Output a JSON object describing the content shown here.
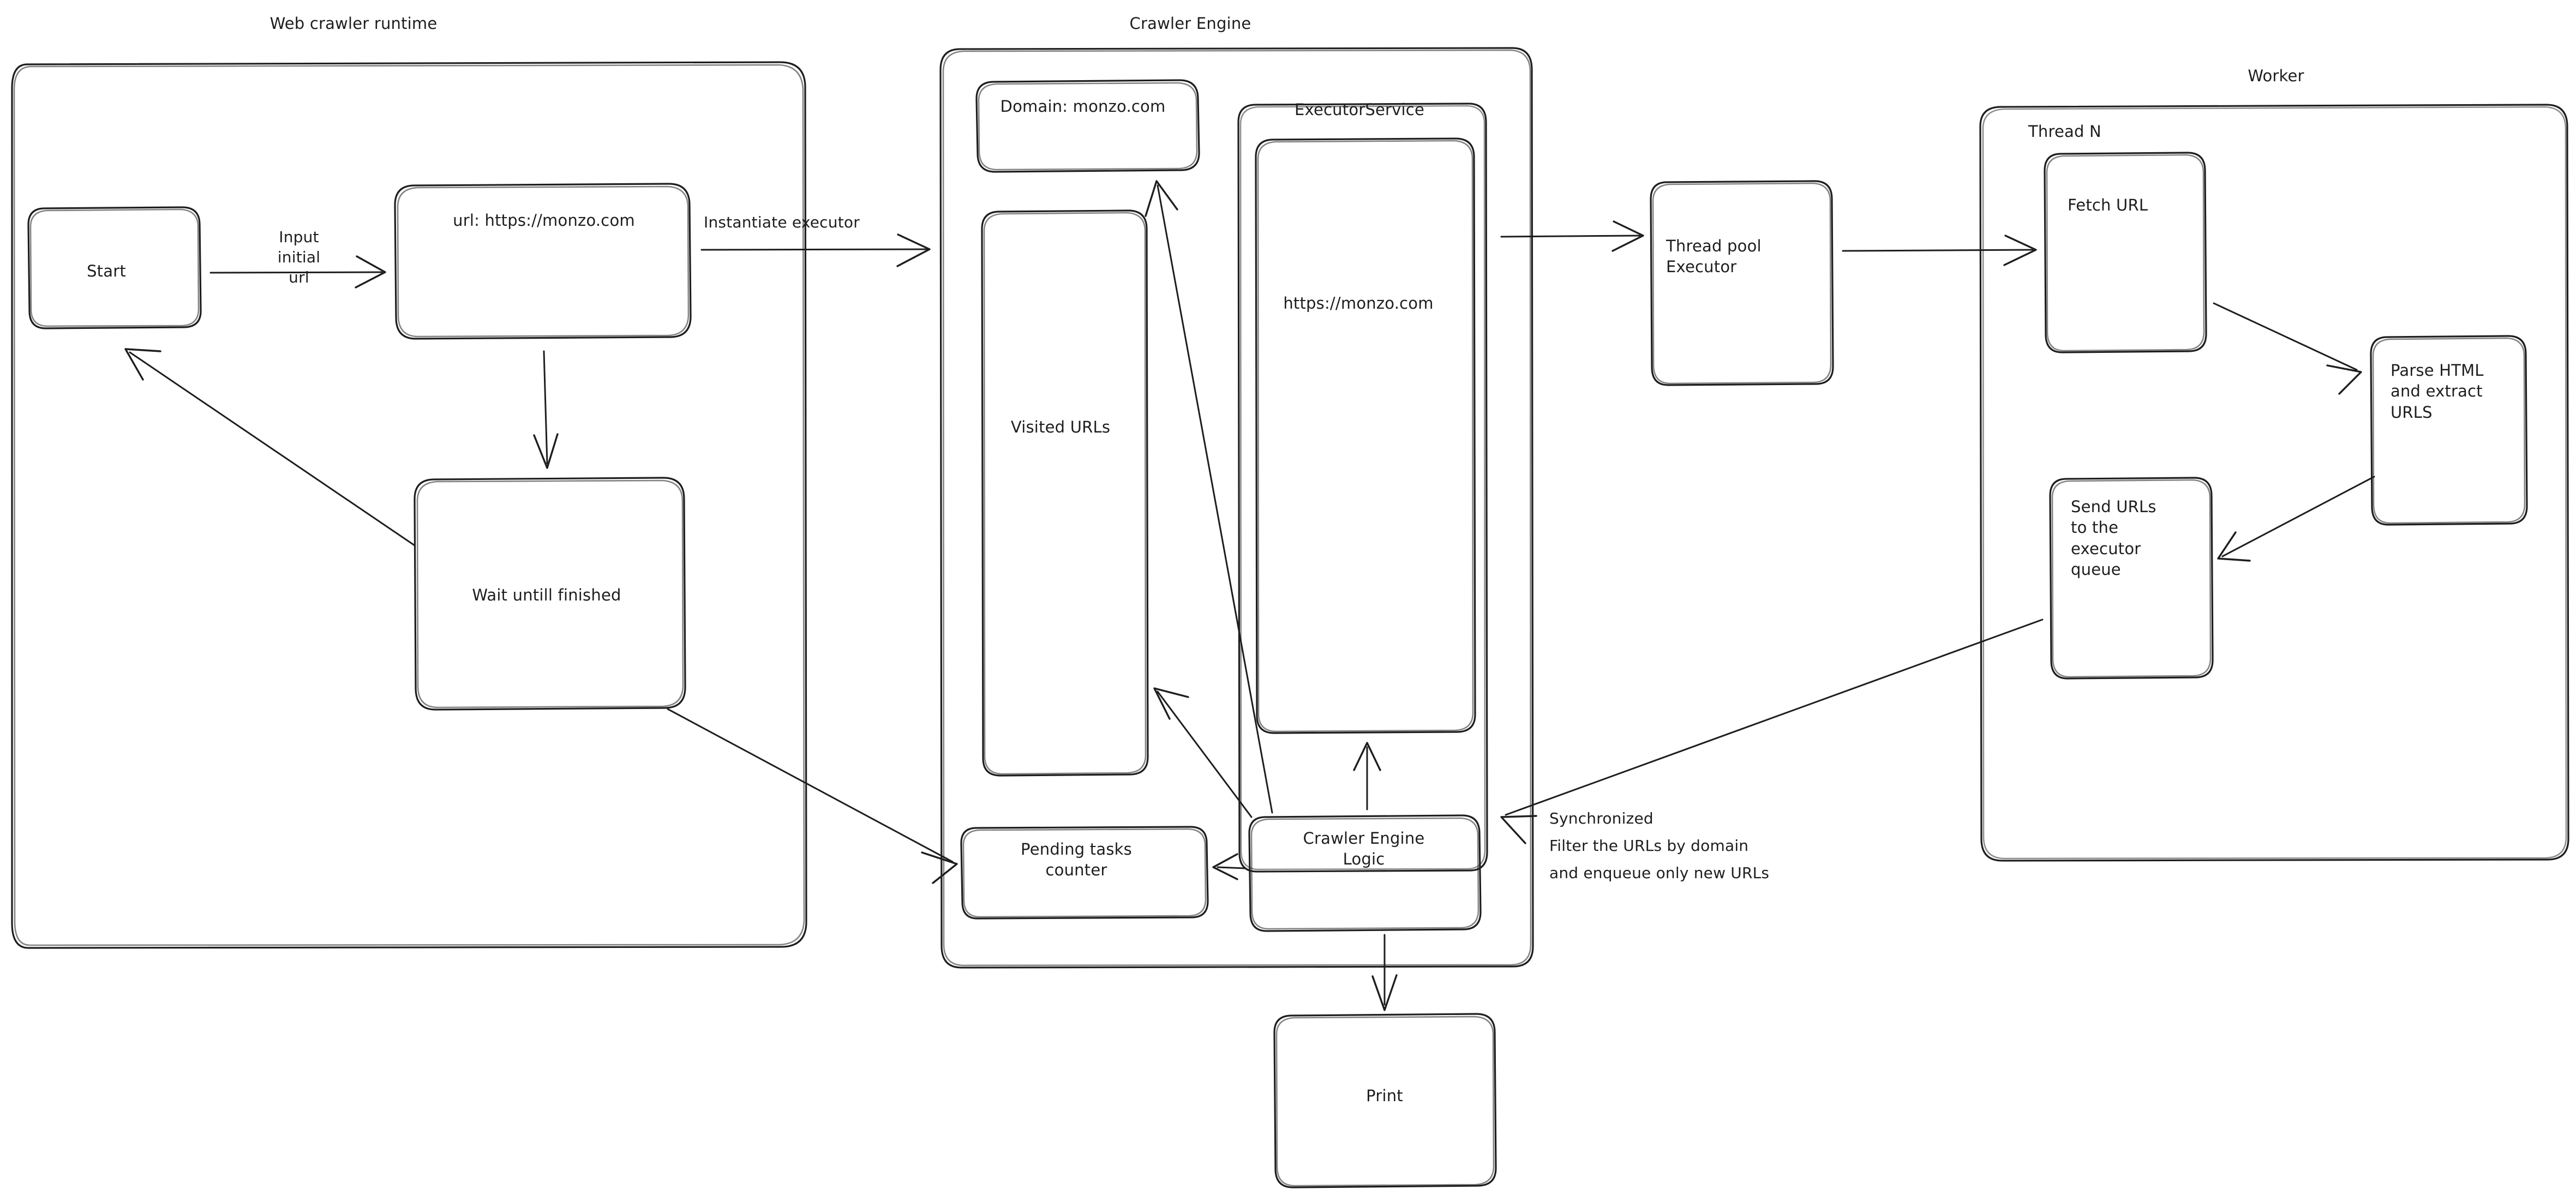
{
  "diagram": {
    "style": "hand-drawn",
    "background_color": "#ffffff",
    "stroke_color": "#1e1e1e",
    "groups": [
      {
        "id": "web-crawler-runtime",
        "label": "Web crawler runtime"
      },
      {
        "id": "crawler-engine",
        "label": "Crawler Engine"
      },
      {
        "id": "executor-service",
        "label": "ExecutorService"
      },
      {
        "id": "worker",
        "label": "Worker"
      },
      {
        "id": "thread-n",
        "label": "Thread N"
      }
    ],
    "nodes": [
      {
        "id": "start",
        "label": "Start"
      },
      {
        "id": "url-input",
        "label": "url: https://monzo.com"
      },
      {
        "id": "wait-until-finished",
        "label": "Wait untill finished"
      },
      {
        "id": "domain",
        "label": "Domain: monzo.com"
      },
      {
        "id": "visited-urls",
        "label": "Visited URLs"
      },
      {
        "id": "executor-queue-url",
        "label": "https://monzo.com"
      },
      {
        "id": "pending-tasks-counter",
        "label": "Pending tasks\ncounter"
      },
      {
        "id": "crawler-engine-logic",
        "label": "Crawler Engine\nLogic"
      },
      {
        "id": "print",
        "label": "Print"
      },
      {
        "id": "thread-pool-executor",
        "label": "Thread pool\nExecutor"
      },
      {
        "id": "fetch-url",
        "label": "Fetch URL"
      },
      {
        "id": "parse-html",
        "label": "Parse HTML\nand extract\nURLS"
      },
      {
        "id": "send-urls",
        "label": "Send URLs\nto the\nexecutor\nqueue"
      }
    ],
    "edges": [
      {
        "id": "start-to-url",
        "from": "start",
        "to": "url-input",
        "label": "Input\ninitial\nurl"
      },
      {
        "id": "url-to-engine",
        "from": "url-input",
        "to": "crawler-engine",
        "label": "Instantiate executor"
      },
      {
        "id": "url-to-wait",
        "from": "url-input",
        "to": "wait-until-finished",
        "label": ""
      },
      {
        "id": "wait-to-start",
        "from": "wait-until-finished",
        "to": "start",
        "label": ""
      },
      {
        "id": "wait-to-pending",
        "from": "wait-until-finished",
        "to": "pending-tasks-counter",
        "label": ""
      },
      {
        "id": "engine-to-threadpool",
        "from": "executor-service",
        "to": "thread-pool-executor",
        "label": ""
      },
      {
        "id": "threadpool-to-fetch",
        "from": "thread-pool-executor",
        "to": "fetch-url",
        "label": ""
      },
      {
        "id": "fetch-to-parse",
        "from": "fetch-url",
        "to": "parse-html",
        "label": ""
      },
      {
        "id": "parse-to-send",
        "from": "parse-html",
        "to": "send-urls",
        "label": ""
      },
      {
        "id": "send-to-logic",
        "from": "send-urls",
        "to": "crawler-engine-logic",
        "label": "Synchronized\nFilter the URLs by domain\nand enqueue only new URLs"
      },
      {
        "id": "logic-to-domain",
        "from": "crawler-engine-logic",
        "to": "domain",
        "label": ""
      },
      {
        "id": "logic-to-visited",
        "from": "crawler-engine-logic",
        "to": "visited-urls",
        "label": ""
      },
      {
        "id": "logic-to-queue",
        "from": "crawler-engine-logic",
        "to": "executor-queue-url",
        "label": ""
      },
      {
        "id": "logic-to-pending",
        "from": "crawler-engine-logic",
        "to": "pending-tasks-counter",
        "label": ""
      },
      {
        "id": "logic-to-print",
        "from": "crawler-engine-logic",
        "to": "print",
        "label": ""
      }
    ],
    "annotations": [
      {
        "id": "synchronized-note",
        "line1": "Synchronized",
        "line2": "Filter the URLs by domain",
        "line3": "and enqueue only new URLs"
      }
    ]
  }
}
